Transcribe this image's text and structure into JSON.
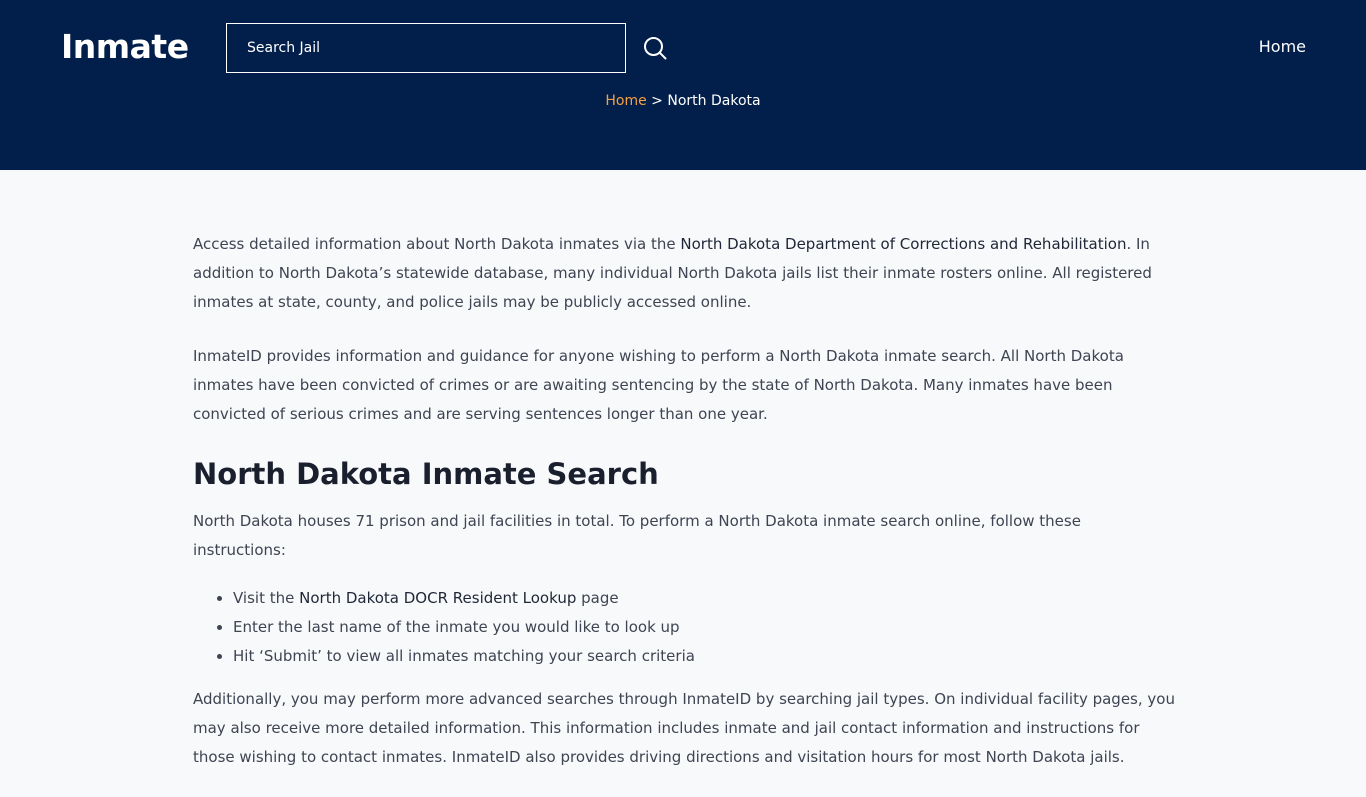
{
  "header": {
    "logo": "Inmate",
    "search_placeholder": "Search Jail",
    "nav_home": "Home"
  },
  "breadcrumb": {
    "home": "Home",
    "separator": " > ",
    "current": "North Dakota"
  },
  "content": {
    "p1_a": "Access detailed information about North Dakota inmates via the ",
    "p1_link": "North Dakota Department of Corrections and Rehabilitation",
    "p1_b": ". In addition to North Dakota’s statewide database, many individual North Dakota jails list their inmate rosters online. All registered inmates at state, county, and police jails may be publicly accessed online.",
    "p2": "InmateID provides information and guidance for anyone wishing to perform a North Dakota inmate search. All North Dakota inmates have been convicted of crimes or are awaiting sentencing by the state of North Dakota. Many inmates have been convicted of serious crimes and are serving sentences longer than one year.",
    "heading": "North Dakota Inmate Search",
    "p3": "North Dakota houses 71 prison and jail facilities in total. To perform a North Dakota inmate search online, follow these instructions:",
    "list": {
      "item1_a": "Visit the ",
      "item1_link": "North Dakota DOCR Resident Lookup",
      "item1_b": " page",
      "item2": "Enter the last name of the inmate you would like to look up",
      "item3": "Hit ‘Submit’ to view all inmates matching your search criteria"
    },
    "p4": "Additionally, you may perform more advanced searches through InmateID by searching jail types. On individual facility pages, you may also receive more detailed information. This information includes inmate and jail contact information and instructions for those wishing to contact inmates. InmateID also provides driving directions and visitation hours for most North Dakota jails."
  },
  "colors": {
    "header_bg": "#021e4a",
    "breadcrumb_link": "#f5a142",
    "page_bg": "#f8f9fb"
  },
  "icons": {
    "search": "search-icon"
  }
}
